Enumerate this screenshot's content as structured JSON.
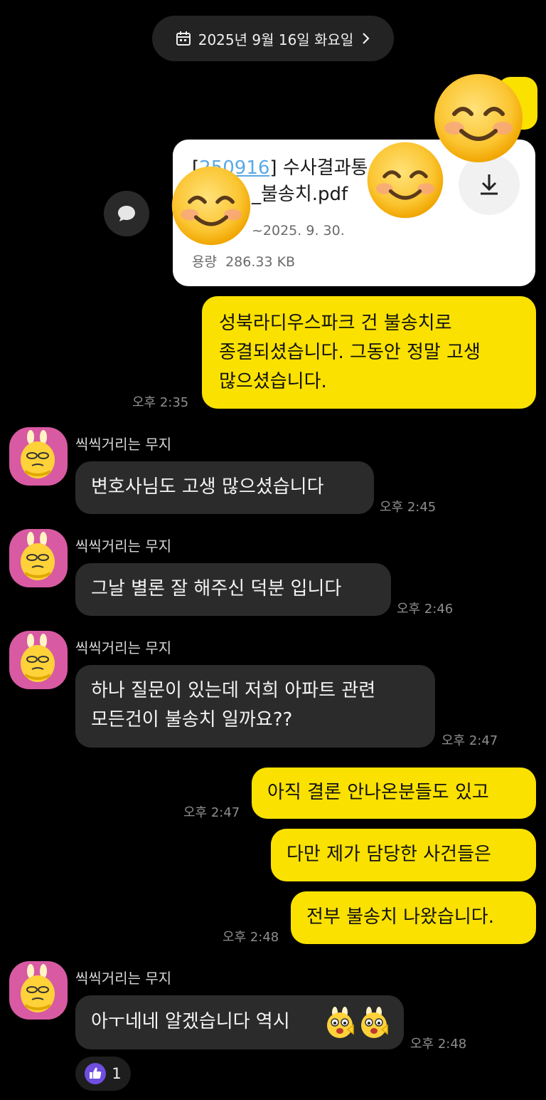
{
  "date_header": {
    "label": "2025년 9월 16일 화요일",
    "icon": "calendar-icon"
  },
  "file_message": {
    "title_prefix": "[",
    "title_link": "250916",
    "title_suffix": "] 수사결과통",
    "title_line2": "_불송치.pdf",
    "expiry": "~2025. 9. 30.",
    "size_label": "용량",
    "size_value": "286.33 KB",
    "download_icon": "download-icon",
    "share_icon": "speech-bubble-icon"
  },
  "messages": [
    {
      "id": "m1",
      "side": "me",
      "lines": [
        "성북라디우스파크 건 불송치로",
        "종결되셨습니다. 그동안 정말 고생",
        "많으셨습니다."
      ],
      "time": "오후 2:35"
    },
    {
      "id": "m2",
      "side": "them",
      "sender": "씩씩거리는 무지",
      "text": "변호사님도 고생 많으셨습니다",
      "time": "오후 2:45"
    },
    {
      "id": "m3",
      "side": "them",
      "sender": "씩씩거리는 무지",
      "text": "그날 별론 잘 해주신 덕분 입니다",
      "time": "오후 2:46"
    },
    {
      "id": "m4",
      "side": "them",
      "sender": "씩씩거리는 무지",
      "lines": [
        "하나 질문이 있는데 저희 아파트 관련",
        "모든건이 불송치 일까요??"
      ],
      "time": "오후 2:47"
    },
    {
      "id": "m5",
      "side": "me",
      "text": "아직 결론 안나온분들도 있고",
      "time": "오후 2:47"
    },
    {
      "id": "m6",
      "side": "me",
      "text": "다만 제가 담당한 사건들은"
    },
    {
      "id": "m7",
      "side": "me",
      "text": "전부 불송치 나왔습니다.",
      "time": "오후 2:48"
    },
    {
      "id": "m8",
      "side": "them",
      "sender": "씩씩거리는 무지",
      "text": "아ㅜ네네 알겠습니다 역시",
      "time": "오후 2:48",
      "emoticons": [
        "muji-emoticon",
        "muji-emoticon"
      ]
    }
  ],
  "reaction": {
    "icon": "thumbs-up-icon",
    "count": "1"
  },
  "colors": {
    "background": "#000000",
    "my_bubble": "#fae100",
    "their_bubble": "#2b2b2b",
    "avatar_bg": "#d85aa2",
    "link": "#5aa9e6",
    "reaction_icon": "#6f4ee0"
  }
}
